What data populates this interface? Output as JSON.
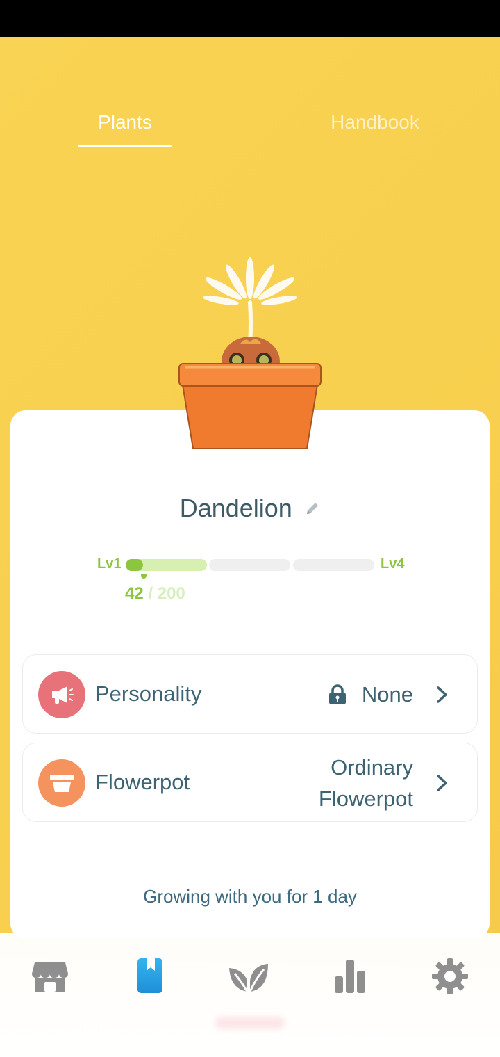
{
  "tabs": [
    {
      "label": "Plants",
      "active": true
    },
    {
      "label": "Handbook",
      "active": false
    }
  ],
  "plant": {
    "name": "Dandelion",
    "level_start": "Lv1",
    "level_end": "Lv4",
    "xp_current": "42",
    "xp_separator": "/",
    "xp_total": "200",
    "progress_fraction": 0.21
  },
  "rows": {
    "personality": {
      "label": "Personality",
      "value": "None",
      "locked": true
    },
    "flowerpot": {
      "label": "Flowerpot",
      "value_line1": "Ordinary",
      "value_line2": "Flowerpot"
    }
  },
  "growing_text": "Growing with you for 1 day",
  "nav": {
    "items": [
      {
        "name": "shop",
        "icon": "store-icon"
      },
      {
        "name": "handbook",
        "icon": "bookmark-icon",
        "active": true
      },
      {
        "name": "plants",
        "icon": "leaves-icon"
      },
      {
        "name": "stats",
        "icon": "bar-chart-icon"
      },
      {
        "name": "settings",
        "icon": "gear-icon"
      }
    ]
  },
  "colors": {
    "background": "#f9d353",
    "accent_green": "#8cc63f",
    "text_teal": "#3d6272",
    "personality_icon_bg": "#e8727a",
    "flowerpot_icon_bg": "#f4935d",
    "active_nav": "#2ba6e8"
  }
}
